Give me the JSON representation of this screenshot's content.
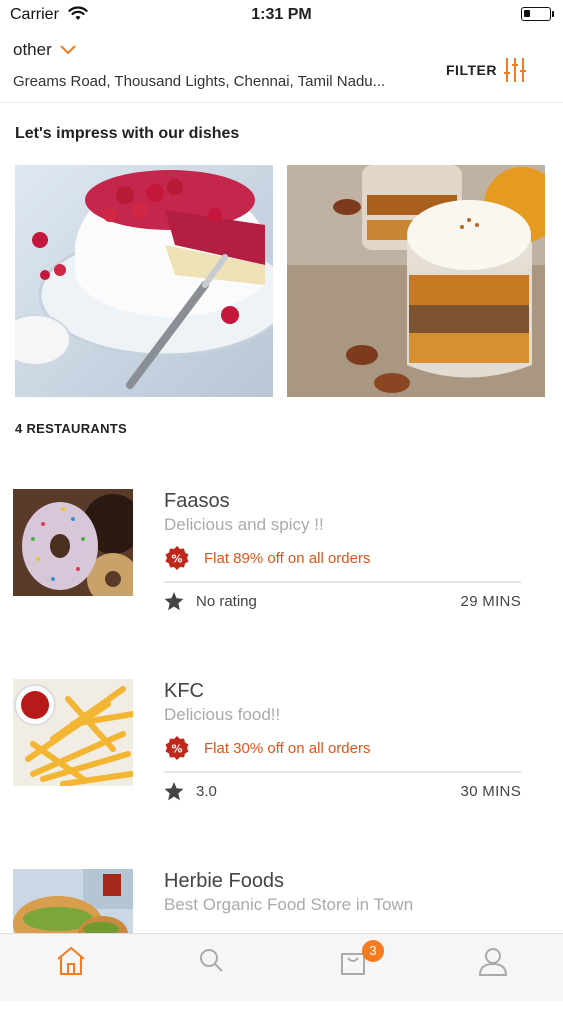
{
  "status_bar": {
    "carrier": "Carrier",
    "time": "1:31 PM",
    "battery_level": 0.25
  },
  "header": {
    "location_label": "other",
    "address": "Greams Road, Thousand Lights, Chennai, Tamil Nadu...",
    "filter_label": "FILTER"
  },
  "dishes_section": {
    "title": "Let's impress with our dishes"
  },
  "restaurants_count": "4 RESTAURANTS",
  "restaurants": [
    {
      "name": "Faasos",
      "description": "Delicious and spicy !!",
      "offer": "Flat 89% off on all orders",
      "rating": "No rating",
      "time": "29 MINS"
    },
    {
      "name": "KFC",
      "description": "Delicious food!!",
      "offer": "Flat 30% off on all orders",
      "rating": "3.0",
      "time": "30 MINS"
    },
    {
      "name": "Herbie Foods",
      "description": "Best Organic Food Store in Town"
    }
  ],
  "tab_bar": {
    "cart_count": "3",
    "active_tab": "home"
  },
  "colors": {
    "accent": "#f47b20",
    "offer_text": "#e0541a",
    "badge_red": "#c0281b"
  }
}
